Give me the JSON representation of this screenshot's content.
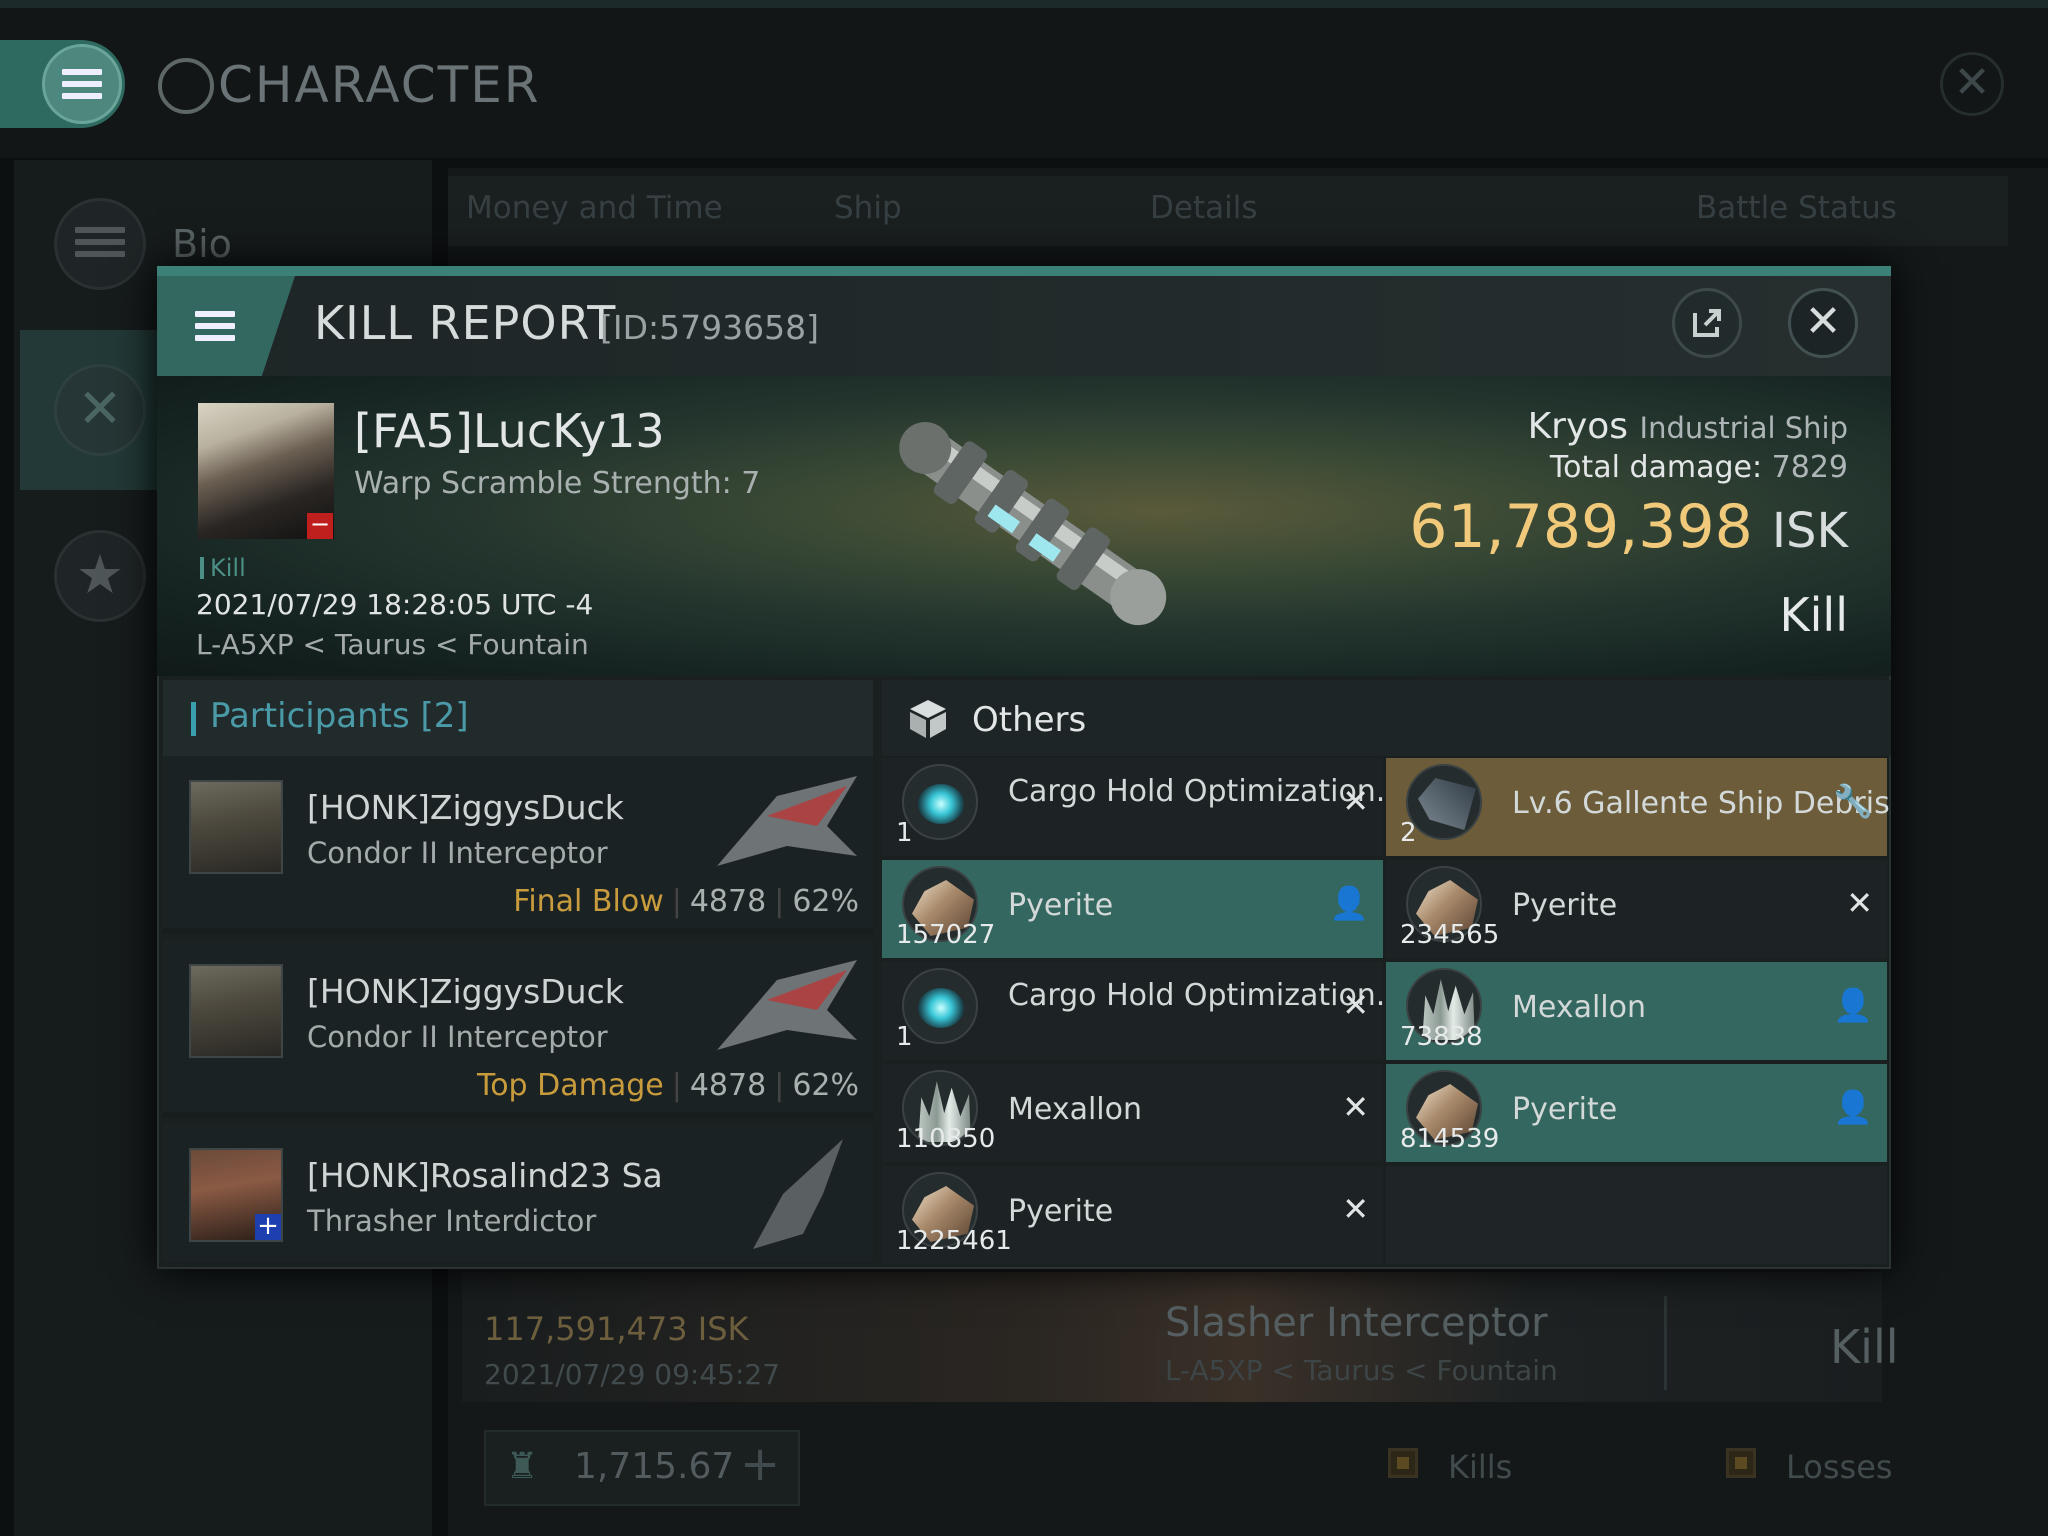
{
  "app": {
    "title": "CHARACTER"
  },
  "sidebar": {
    "bio_label": "Bio"
  },
  "bg_tabs": [
    "Money and Time",
    "Ship",
    "Details",
    "Battle Status"
  ],
  "bg_row": {
    "isk": "117,591,473  ISK",
    "date": "2021/07/29  09:45:27",
    "ship": "Slasher Interceptor",
    "loc": "L-A5XP < Taurus < Fountain",
    "result": "Kill"
  },
  "bg_footer": {
    "balance": "1,715.67",
    "kills_label": "Kills",
    "losses_label": "Losses"
  },
  "modal": {
    "title": "KILL REPORT",
    "id": "[ID:5793658]",
    "victim": {
      "name": "[FA5]LucKy13",
      "warp": "Warp Scramble Strength: 7",
      "tag": "Kill",
      "time": "2021/07/29 18:28:05 UTC -4",
      "location": "L-A5XP < Taurus < Fountain"
    },
    "ship": {
      "name": "Kryos",
      "class": "Industrial Ship"
    },
    "damage": {
      "label": "Total damage:",
      "value": "7829"
    },
    "isk": {
      "value": "61,789,398",
      "unit": "ISK"
    },
    "result": "Kill",
    "participants": {
      "title": "Participants",
      "count": "[2]",
      "rows": [
        {
          "name": "[HONK]ZiggysDuck",
          "ship": "Condor II Interceptor",
          "tag": "Final Blow",
          "damage": "4878",
          "pct": "62%"
        },
        {
          "name": "[HONK]ZiggysDuck",
          "ship": "Condor II Interceptor",
          "tag": "Top Damage",
          "damage": "4878",
          "pct": "62%"
        },
        {
          "name": "[HONK]Rosalind23 Sa",
          "ship": "Thrasher Interdictor",
          "tag": "",
          "damage": "",
          "pct": ""
        }
      ]
    },
    "others": {
      "title": "Others",
      "items": [
        {
          "name": "Cargo Hold Optimization...",
          "qty": "1",
          "status": "x",
          "style": "dark",
          "icon": "lens-module-icon"
        },
        {
          "name": "Lv.6 Gallente Ship Debris",
          "qty": "2",
          "status": "wrench",
          "style": "gold",
          "icon": "ship-debris-icon"
        },
        {
          "name": "Pyerite",
          "qty": "157027",
          "status": "person",
          "style": "teal",
          "icon": "pyerite-ore-icon"
        },
        {
          "name": "Pyerite",
          "qty": "234565",
          "status": "x",
          "style": "dark",
          "icon": "pyerite-ore-icon"
        },
        {
          "name": "Cargo Hold Optimization...",
          "qty": "1",
          "status": "x",
          "style": "dark",
          "icon": "lens-module-icon"
        },
        {
          "name": "Mexallon",
          "qty": "73838",
          "status": "person",
          "style": "teal",
          "icon": "mexallon-ore-icon"
        },
        {
          "name": "Mexallon",
          "qty": "110850",
          "status": "x",
          "style": "dark",
          "icon": "mexallon-ore-icon"
        },
        {
          "name": "Pyerite",
          "qty": "814539",
          "status": "person",
          "style": "teal",
          "icon": "pyerite-ore-icon"
        },
        {
          "name": "Pyerite",
          "qty": "1225461",
          "status": "x",
          "style": "dark",
          "icon": "pyerite-ore-icon"
        }
      ]
    }
  },
  "colors": {
    "accent": "#3c8178",
    "gold": "#f0c97a",
    "teal_row": "#34675f",
    "gold_row": "#6c5c3a"
  }
}
